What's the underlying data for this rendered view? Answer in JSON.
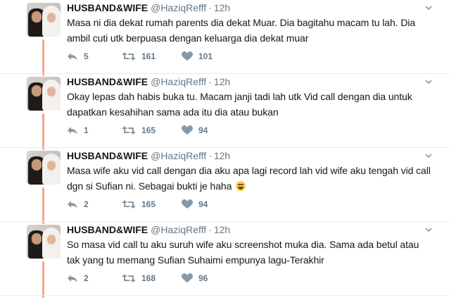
{
  "colors": {
    "thread_line": "#f4a58a",
    "meta_text": "#657786",
    "body_text": "#14171a",
    "divider": "#e6ecf0"
  },
  "icons": {
    "reply": "reply-icon",
    "retweet": "retweet-icon",
    "like": "heart-icon",
    "menu": "chevron-down-icon"
  },
  "tweets": [
    {
      "name": "HUSBAND&WIFE",
      "handle": "@HaziqRefff",
      "dot": "·",
      "time": "12h",
      "text": "Masa ni dia dekat rumah parents dia dekat Muar. Dia bagitahu macam tu lah. Dia ambil cuti utk berpuasa dengan keluarga dia dekat muar",
      "replies": "5",
      "retweets": "161",
      "likes": "101"
    },
    {
      "name": "HUSBAND&WIFE",
      "handle": "@HaziqRefff",
      "dot": "·",
      "time": "12h",
      "text": "Okay lepas dah habis buka tu. Macam janji tadi lah utk Vid call dengan dia untuk dapatkan kesahihan sama ada itu dia atau bukan",
      "replies": "1",
      "retweets": "165",
      "likes": "94"
    },
    {
      "name": "HUSBAND&WIFE",
      "handle": "@HaziqRefff",
      "dot": "·",
      "time": "12h",
      "text": "Masa wife aku vid call dengan dia aku apa lagi record lah vid wife aku tengah vid call dgn si Sufian ni. Sebagai bukti je haha",
      "replies": "2",
      "retweets": "165",
      "likes": "94"
    },
    {
      "name": "HUSBAND&WIFE",
      "handle": "@HaziqRefff",
      "dot": "·",
      "time": "12h",
      "text": "So masa vid call tu aku suruh wife aku screenshot muka dia. Sama ada betul atau tak yang tu memang Sufian Suhaimi empunya lagu-Terakhir",
      "replies": "2",
      "retweets": "168",
      "likes": "96"
    }
  ]
}
